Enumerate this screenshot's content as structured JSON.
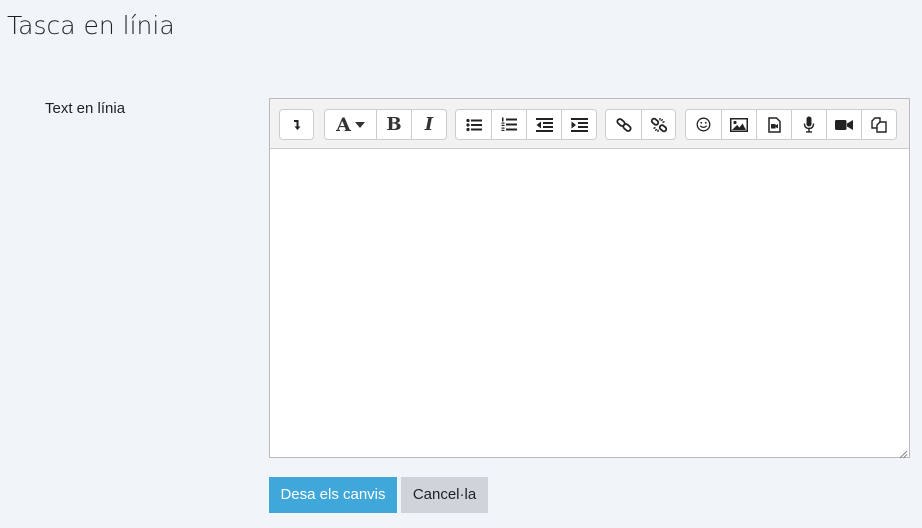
{
  "page": {
    "title": "Tasca en línia"
  },
  "form": {
    "field_label": "Text en línia",
    "editor_content": ""
  },
  "toolbar": {
    "groups": [
      [
        {
          "name": "show-more-buttons",
          "icon": "arrow-down-icon"
        }
      ],
      [
        {
          "name": "font-style",
          "icon": "font-color-icon",
          "glyph": "A"
        },
        {
          "name": "bold",
          "icon": "bold-icon",
          "glyph": "B"
        },
        {
          "name": "italic",
          "icon": "italic-icon",
          "glyph": "I"
        }
      ],
      [
        {
          "name": "unordered-list",
          "icon": "bullet-list-icon"
        },
        {
          "name": "ordered-list",
          "icon": "numbered-list-icon"
        },
        {
          "name": "outdent",
          "icon": "outdent-icon"
        },
        {
          "name": "indent",
          "icon": "indent-icon"
        }
      ],
      [
        {
          "name": "link",
          "icon": "link-icon"
        },
        {
          "name": "unlink",
          "icon": "unlink-icon"
        }
      ],
      [
        {
          "name": "emoji",
          "icon": "smiley-icon"
        },
        {
          "name": "image",
          "icon": "image-icon"
        },
        {
          "name": "media",
          "icon": "media-file-icon"
        },
        {
          "name": "record-audio",
          "icon": "microphone-icon"
        },
        {
          "name": "record-video",
          "icon": "video-camera-icon"
        },
        {
          "name": "manage-files",
          "icon": "copy-files-icon"
        }
      ]
    ]
  },
  "actions": {
    "save_label": "Desa els canvis",
    "cancel_label": "Cancel·la"
  },
  "colors": {
    "background": "#f1f4f8",
    "primary": "#3fa7d9",
    "secondary": "#ced4da",
    "toolbar": "#f2f2f2",
    "border": "#cccccc"
  }
}
